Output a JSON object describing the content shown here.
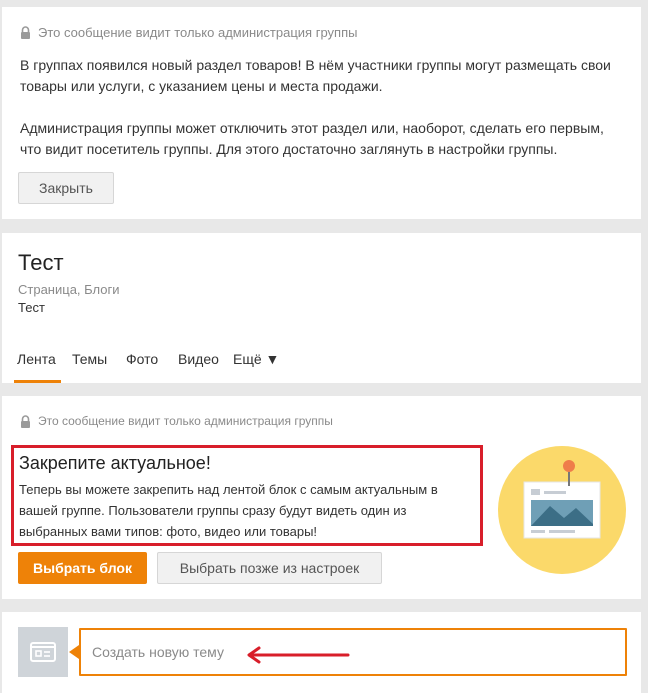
{
  "notice1": {
    "admin_note": "Это сообщение видит только администрация группы",
    "line1": "В группах появился новый раздел товаров! В нём участники группы могут размещать свои",
    "line2": "товары или услуги, с указанием цены и места продажи.",
    "line3": "Администрация группы может отключить этот раздел или, наоборот, сделать его первым,",
    "line4": "что видит посетитель группы. Для этого достаточно заглянуть в настройки группы.",
    "close_label": "Закрыть"
  },
  "group": {
    "title": "Тест",
    "category": "Страница, Блоги",
    "description": "Тест",
    "tabs": [
      "Лента",
      "Темы",
      "Фото",
      "Видео",
      "Ещё ▼"
    ],
    "active_tab": "Лента"
  },
  "notice2": {
    "admin_note": "Это сообщение видит только администрация группы",
    "heading": "Закрепите актуальное!",
    "text1": "Теперь вы можете закрепить над лентой блок с самым актуальным в",
    "text2": "вашей группе. Пользователи группы сразу будут видеть один из",
    "text3": "выбранных вами типов: фото, видео или товары!",
    "choose_label": "Выбрать блок",
    "later_label": "Выбрать позже из настроек"
  },
  "composer": {
    "placeholder": "Создать новую тему"
  },
  "colors": {
    "accent": "#ee8208",
    "highlight_red": "#d81e2a"
  }
}
